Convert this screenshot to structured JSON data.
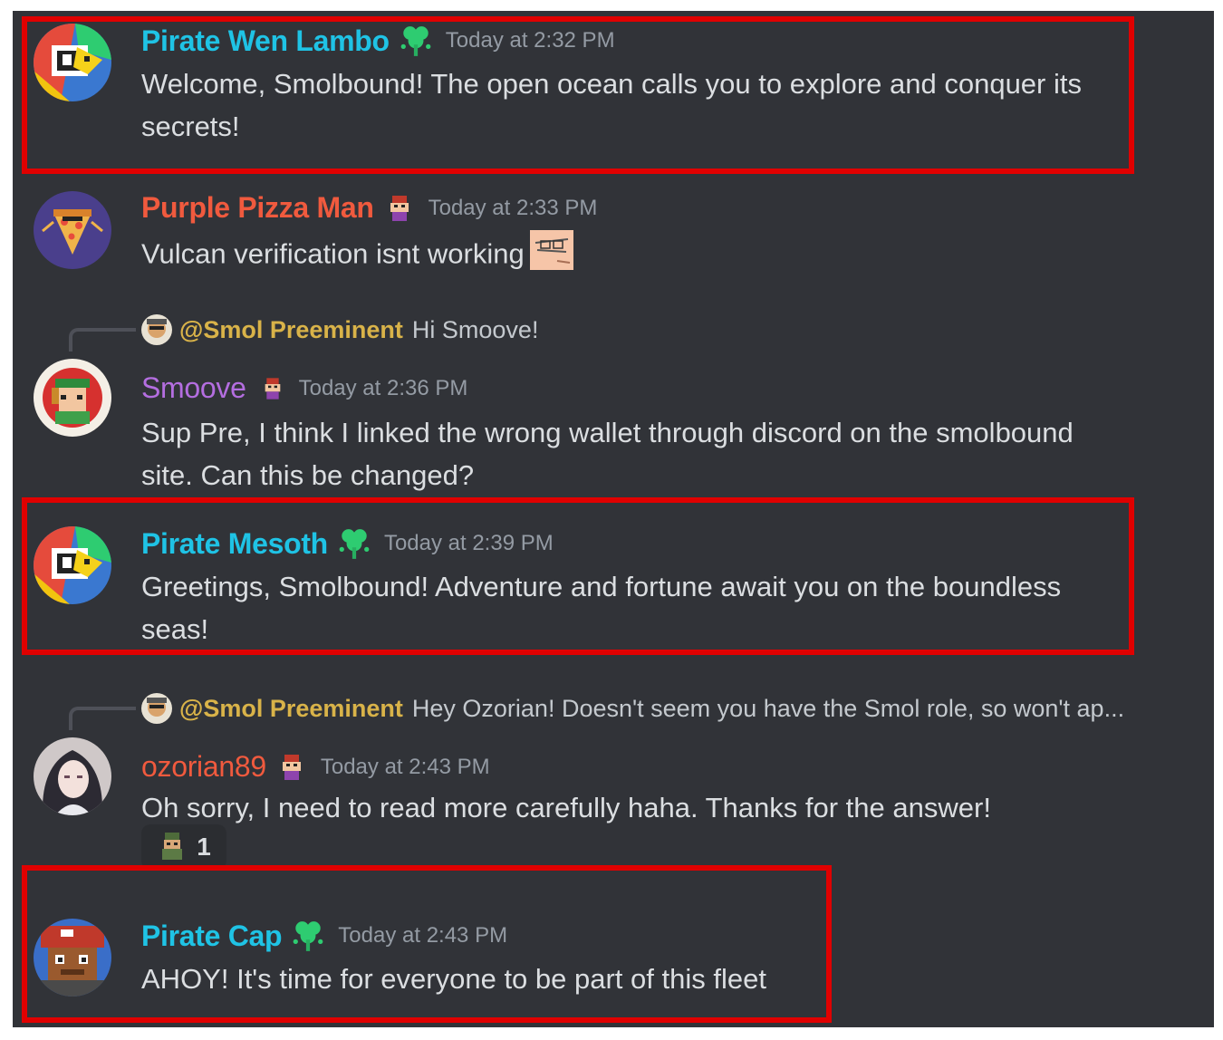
{
  "colors": {
    "background": "#313338",
    "pirate_name": "#1fc3e5",
    "purple_pizza_name": "#f05a3e",
    "smoove_name": "#b46ee0",
    "ozorian_name": "#f05a3e",
    "mention": "#d9b349",
    "timestamp": "#949ba4",
    "message_text": "#dbdee1",
    "highlight_box": "#e00000"
  },
  "messages": [
    {
      "username": "Pirate Wen Lambo",
      "badge_icon": "clover-badge-icon",
      "timestamp": "Today at 2:32 PM",
      "text": "Welcome, Smolbound! The open ocean calls you to explore and conquer its secrets!",
      "highlighted": true
    },
    {
      "username": "Purple Pizza Man",
      "badge_icon": "pixel-character-badge-icon",
      "timestamp": "Today at 2:33 PM",
      "text": "Vulcan verification isnt working",
      "emoji": "facepalm-emoji-icon"
    },
    {
      "reply_to": "@Smol Preeminent",
      "reply_text": "Hi Smoove!",
      "username": "Smoove",
      "badge_icon": "pixel-character-badge-icon",
      "timestamp": "Today at 2:36 PM",
      "text": "Sup Pre, I think I linked the wrong wallet through discord on the smolbound site. Can this be changed?"
    },
    {
      "username": "Pirate Mesoth",
      "badge_icon": "clover-badge-icon",
      "timestamp": "Today at 2:39 PM",
      "text": "Greetings, Smolbound! Adventure and fortune await you on the boundless seas!",
      "highlighted": true
    },
    {
      "reply_to": "@Smol Preeminent",
      "reply_text": "Hey Ozorian! Doesn't seem you have the Smol role, so won't ap...",
      "username": "ozorian89",
      "badge_icon": "pixel-character-badge-icon",
      "timestamp": "Today at 2:43 PM",
      "text": "Oh sorry, I need to read more carefully haha. Thanks for the answer!",
      "reaction": {
        "icon": "soldier-emoji-icon",
        "count": "1"
      }
    },
    {
      "username": "Pirate Cap",
      "badge_icon": "clover-badge-icon",
      "timestamp": "Today at 2:43 PM",
      "text": "AHOY! It's time for everyone to be part of this fleet",
      "highlighted": true
    }
  ]
}
